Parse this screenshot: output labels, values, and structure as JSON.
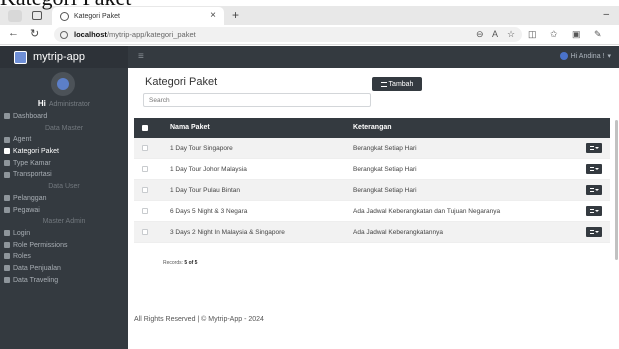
{
  "caption": "Kategori Paket",
  "browser": {
    "tab_title": "Kategori Paket",
    "url_host": "localhost",
    "url_path": "/mytrip-app/kategori_paket"
  },
  "app": {
    "brand": "mytrip-app",
    "user_name_top": "Hi Andina !",
    "sidebar_hi": "Hi",
    "sidebar_role": "Administrator"
  },
  "sidebar": {
    "items": [
      {
        "type": "item",
        "label": "Dashboard"
      },
      {
        "type": "header",
        "label": "Data Master"
      },
      {
        "type": "item",
        "label": "Agent"
      },
      {
        "type": "item",
        "label": "Kategori Paket",
        "active": true
      },
      {
        "type": "item",
        "label": "Type Kamar"
      },
      {
        "type": "item",
        "label": "Transportasi"
      },
      {
        "type": "header",
        "label": "Data User"
      },
      {
        "type": "item",
        "label": "Pelanggan"
      },
      {
        "type": "item",
        "label": "Pegawai"
      },
      {
        "type": "header",
        "label": "Master Admin"
      },
      {
        "type": "item",
        "label": "Login"
      },
      {
        "type": "item",
        "label": "Role Permissions"
      },
      {
        "type": "item",
        "label": "Roles"
      },
      {
        "type": "item",
        "label": "Data Penjualan"
      },
      {
        "type": "item",
        "label": "Data Traveling"
      }
    ]
  },
  "main": {
    "title": "Kategori Paket",
    "add_label": "Tambah",
    "search_placeholder": "Search",
    "columns": [
      "Nama Paket",
      "Keterangan"
    ],
    "rows": [
      {
        "nama": "1 Day Tour Singapore",
        "ket": "Berangkat Setiap Hari"
      },
      {
        "nama": "1 Day Tour Johor Malaysia",
        "ket": "Berangkat Setiap Hari"
      },
      {
        "nama": "1 Day Tour Pulau Bintan",
        "ket": "Berangkat Setiap Hari"
      },
      {
        "nama": "6 Days 5 Night & 3 Negara",
        "ket": "Ada Jadwal Keberangkatan dan Tujuan Negaranya"
      },
      {
        "nama": "3 Days 2 Night In Malaysia & Singapore",
        "ket": "Ada Jadwal Keberangkatannya"
      }
    ],
    "records_label": "Records:",
    "records_value": "5 of 5"
  },
  "footer": "All Rights Reserved | © Mytrip-App - 2024"
}
